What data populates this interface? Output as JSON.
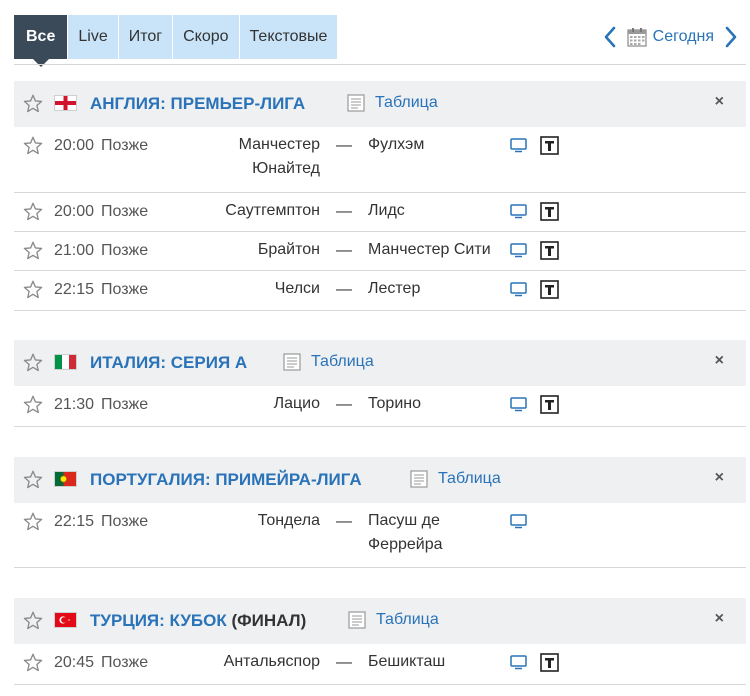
{
  "tabs": [
    {
      "label": "Все",
      "active": true
    },
    {
      "label": "Live",
      "active": false
    },
    {
      "label": "Итог",
      "active": false
    },
    {
      "label": "Скоро",
      "active": false
    },
    {
      "label": "Текстовые",
      "active": false
    }
  ],
  "date_nav": {
    "label": "Сегодня"
  },
  "colors": {
    "accent": "#2a73b8",
    "active_tab": "#3a4a59",
    "tab_bg": "#c9e4f9",
    "header_bg": "#eef0f2"
  },
  "leagues": [
    {
      "country": "АНГЛИЯ",
      "name": "ПРЕМЬЕР-ЛИГА",
      "extra": "",
      "flag": "england",
      "table_label": "Таблица",
      "close": "×",
      "matches": [
        {
          "time": "20:00",
          "status": "Позже",
          "home": "Манчестер Юнайтед",
          "away": "Фулхэм",
          "dash": "—",
          "tv": true,
          "text": true
        },
        {
          "time": "20:00",
          "status": "Позже",
          "home": "Саутгемптон",
          "away": "Лидс",
          "dash": "—",
          "tv": true,
          "text": true
        },
        {
          "time": "21:00",
          "status": "Позже",
          "home": "Брайтон",
          "away": "Манчестер Сити",
          "dash": "—",
          "tv": true,
          "text": true
        },
        {
          "time": "22:15",
          "status": "Позже",
          "home": "Челси",
          "away": "Лестер",
          "dash": "—",
          "tv": true,
          "text": true
        }
      ]
    },
    {
      "country": "ИТАЛИЯ",
      "name": "СЕРИЯ А",
      "extra": "",
      "flag": "italy",
      "table_label": "Таблица",
      "close": "×",
      "matches": [
        {
          "time": "21:30",
          "status": "Позже",
          "home": "Лацио",
          "away": "Торино",
          "dash": "—",
          "tv": true,
          "text": true
        }
      ]
    },
    {
      "country": "ПОРТУГАЛИЯ",
      "name": "ПРИМЕЙРА-ЛИГА",
      "extra": "",
      "flag": "portugal",
      "table_label": "Таблица",
      "close": "×",
      "matches": [
        {
          "time": "22:15",
          "status": "Позже",
          "home": "Тондела",
          "away": "Пасуш де Феррейра",
          "dash": "—",
          "tv": true,
          "text": false
        }
      ]
    },
    {
      "country": "ТУРЦИЯ",
      "name": "КУБОК",
      "extra": "(ФИНАЛ)",
      "flag": "turkey",
      "table_label": "Таблица",
      "close": "×",
      "matches": [
        {
          "time": "20:45",
          "status": "Позже",
          "home": "Антальяспор",
          "away": "Бешикташ",
          "dash": "—",
          "tv": true,
          "text": true
        }
      ]
    }
  ]
}
